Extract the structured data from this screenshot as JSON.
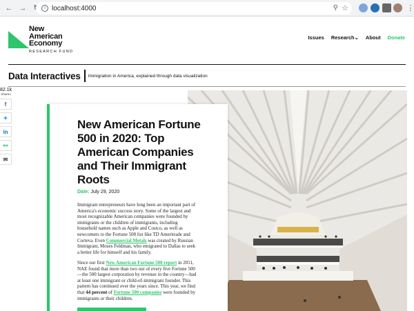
{
  "browser": {
    "url": "localhost:4000"
  },
  "header": {
    "logo_line1": "New",
    "logo_line2": "American",
    "logo_line3": "Economy",
    "logo_sub": "RESEARCH FUND",
    "nav": {
      "issues": "Issues",
      "research": "Research",
      "about": "About",
      "donate": "Donate"
    }
  },
  "section": {
    "title": "Data Interactives",
    "subtitle": "Immigration in America, explained through data visualization"
  },
  "share": {
    "count": "82.1k",
    "label": "Shares"
  },
  "article": {
    "title": "New American Fortune 500 in 2020: Top American Companies and Their Immigrant Roots",
    "date_label": "Date:",
    "date_value": "July 29, 2020",
    "p1_text": "Immigrant entrepreneurs have long been an important part of America's economic success story. Some of the largest and most recognizable American companies were founded by immigrants or the children of immigrants, including household names such as Apple and Costco, as well as newcomers to the Fortune 500 list like TD Ameritrade and Corteva. Even ",
    "p1_link": "Commercial Metals",
    "p1_rest": " was created by Russian Immigrant, Moses Feldman, who emigrated to Dallas to seek a better life for himself and his family.",
    "p2_a": "Since our first ",
    "p2_link1": "New American Fortune 500 report",
    "p2_b": " in 2011, NAE found that more than two out of every five Fortune 500—the 500 largest corporation by revenue in the country—had at least one immigrant or child-of-immigrant founder. This pattern has continued over the years since. This year, we find that ",
    "p2_bold": "44 percent",
    "p2_c": " of ",
    "p2_link2": "Fortune 500 companies",
    "p2_d": " were founded by immigrants or their children."
  },
  "colors": {
    "brand_green": "#2ec56b"
  }
}
